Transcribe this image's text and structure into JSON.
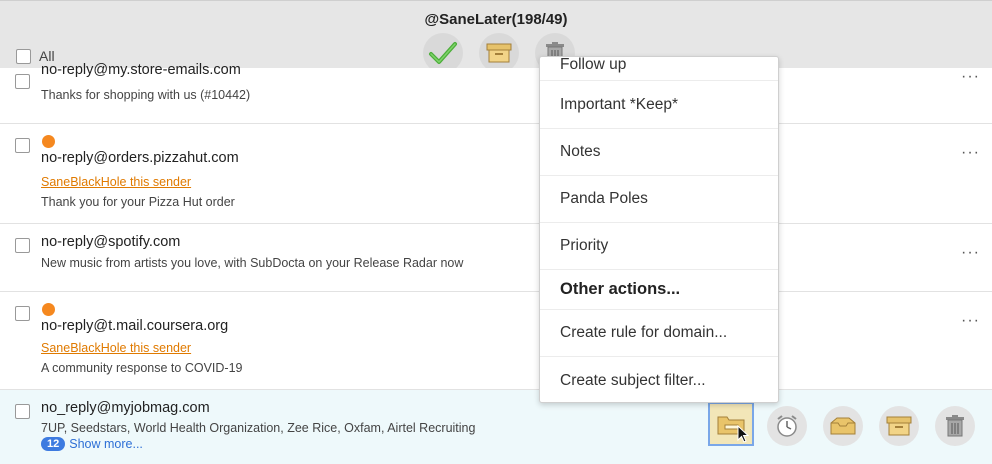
{
  "header": {
    "folder_title": "@SaneLater(198/49)",
    "select_all_label": "All",
    "actions": [
      {
        "name": "done",
        "icon": "checkmark-icon"
      },
      {
        "name": "archive",
        "icon": "archive-box-icon"
      },
      {
        "name": "delete",
        "icon": "trash-icon"
      }
    ]
  },
  "emails": [
    {
      "sender": "no-reply@my.store-emails.com",
      "preview": "Thanks for shopping with us (#10442)"
    },
    {
      "sender": "no-reply@orders.pizzahut.com",
      "blackhole_link": "SaneBlackHole this sender",
      "preview": "Thank you for your Pizza Hut order",
      "unread": true
    },
    {
      "sender": "no-reply@spotify.com",
      "preview": "New music from artists you love, with SubDocta on your Release Radar now"
    },
    {
      "sender": "no-reply@t.mail.coursera.org",
      "blackhole_link": "SaneBlackHole this sender",
      "preview": "A community response to COVID-19",
      "unread": true
    },
    {
      "sender": "no_reply@myjobmag.com",
      "preview": "7UP, Seedstars, World Health Organization, Zee Rice, Oxfam, Airtel Recruiting",
      "badge": "12",
      "show_more": "Show more..."
    }
  ],
  "more_glyph": "···",
  "dropdown": {
    "items": [
      "Follow up",
      "Important *Keep*",
      "Notes",
      "Panda Poles",
      "Priority"
    ],
    "heading": "Other actions...",
    "actions": [
      "Create rule for domain...",
      "Create subject filter..."
    ]
  },
  "colors": {
    "header_bg": "#e6e6e6",
    "unread_dot": "#f5881f",
    "link_orange": "#e07a00",
    "badge_blue": "#3d7be0",
    "highlight_row": "#eef9fb"
  }
}
